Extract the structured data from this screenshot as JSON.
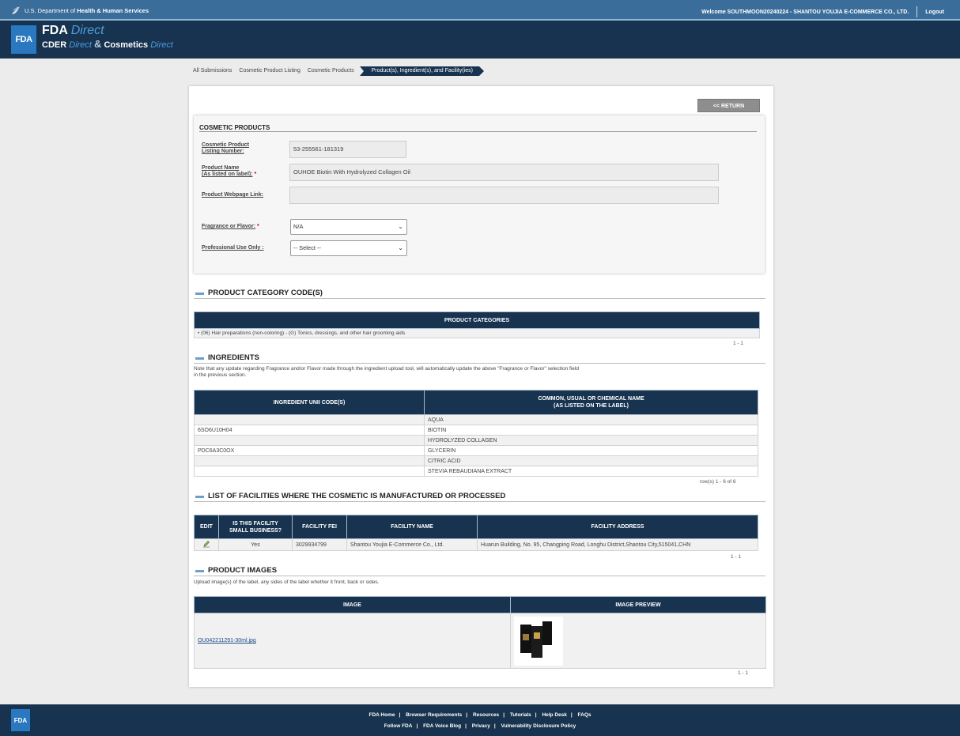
{
  "hhs_bar": {
    "agency_prefix": "U.S. Department of ",
    "agency_name": "Health & Human Services",
    "welcome": "Welcome SOUTHMOON20240224 - SHANTOU YOUJIA E-COMMERCE CO., LTD.",
    "logout": "Logout"
  },
  "header": {
    "logo": "FDA",
    "fda": "FDA",
    "direct": "Direct",
    "cder": "CDER",
    "amp": "&",
    "cosmetics": "Cosmetics"
  },
  "breadcrumb": [
    "All Submissions",
    "Cosmetic Product Listing",
    "Cosmetic Products",
    "Product(s), Ingredient(s), and Facility(ies)"
  ],
  "return_button": "<< RETURN",
  "cosmetic_products": {
    "title": "COSMETIC PRODUCTS",
    "listing_label_1": "Cosmetic Product",
    "listing_label_2": "Listing Number:",
    "listing_value": "53-255561-181319",
    "name_label_1": "Product Name",
    "name_label_2": "(As listed on label):",
    "name_value": "OUHOE Biotin With Hydrolyzed Collagen Oil",
    "webpage_label": "Product Webpage Link:",
    "webpage_value": "",
    "fragrance_label": "Fragrance or Flavor:",
    "fragrance_value": "N/A",
    "professional_label": "Professional Use Only :",
    "professional_value": "-- Select --",
    "required_mark": "*"
  },
  "category": {
    "title": "PRODUCT CATEGORY CODE(S)",
    "header": "PRODUCT CATEGORIES",
    "item": "(06) Hair preparations (non-coloring) - (G) Tonics, dressings, and other hair grooming aids",
    "pager": "1 - 1"
  },
  "ingredients": {
    "title": "INGREDIENTS",
    "note_1": "Note that any update regarding Fragrance and/or Flavor made through the ingredient upload tool, will automatically update the above \"Fragrance or Flavor\" selection field",
    "note_2": "in the previous section.",
    "col_unii": "INGREDIENT UNII CODE(S)",
    "col_name_1": "COMMON, USUAL OR CHEMICAL NAME",
    "col_name_2": "(AS LISTED ON THE LABEL)",
    "rows": [
      {
        "unii": "",
        "name": "AQUA"
      },
      {
        "unii": "6SO6U10H04",
        "name": "BIOTIN"
      },
      {
        "unii": "",
        "name": "HYDROLYZED COLLAGEN"
      },
      {
        "unii": "PDC6A3C0OX",
        "name": "GLYCERIN"
      },
      {
        "unii": "",
        "name": "CITRIC ACID"
      },
      {
        "unii": "",
        "name": "STEVIA REBAUDIANA EXTRACT"
      }
    ],
    "pager": "row(s) 1 - 6 of 6"
  },
  "facilities": {
    "title": "LIST OF FACILITIES WHERE THE COSMETIC IS MANUFACTURED OR PROCESSED",
    "col_edit": "EDIT",
    "col_small_1": "IS THIS FACILITY",
    "col_small_2": "SMALL BUSINESS?",
    "col_fei": "FACILITY FEI",
    "col_name": "FACILITY NAME",
    "col_address": "FACILITY ADDRESS",
    "row": {
      "small": "Yes",
      "fei": "3029934799",
      "name": "Shantou Youjia E-Commerce Co., Ltd.",
      "address": "Huarun Building, No. 95, Changping Road, Longhu District,Shantou City,515041,CHN"
    },
    "pager": "1 - 1"
  },
  "images": {
    "title": "PRODUCT IMAGES",
    "note": "Upload image(s) of the label, any sides of the label whether it front, back or sides.",
    "col_image": "IMAGE",
    "col_preview": "IMAGE PREVIEW",
    "file": "OU042211291-30ml.jpg",
    "pager": "1 - 1"
  },
  "footer": {
    "logo": "FDA",
    "row1": [
      "FDA Home",
      "Browser Requirements",
      "Resources",
      "Tutorials",
      "Help Desk",
      "FAQs"
    ],
    "row2": [
      "Follow FDA",
      "FDA Voice Blog",
      "Privacy",
      "Vulnerability Disclosure Policy"
    ]
  },
  "colors": {
    "navy": "#17334f",
    "hhs_blue": "#3a6d99",
    "accent": "#2a78c0"
  }
}
